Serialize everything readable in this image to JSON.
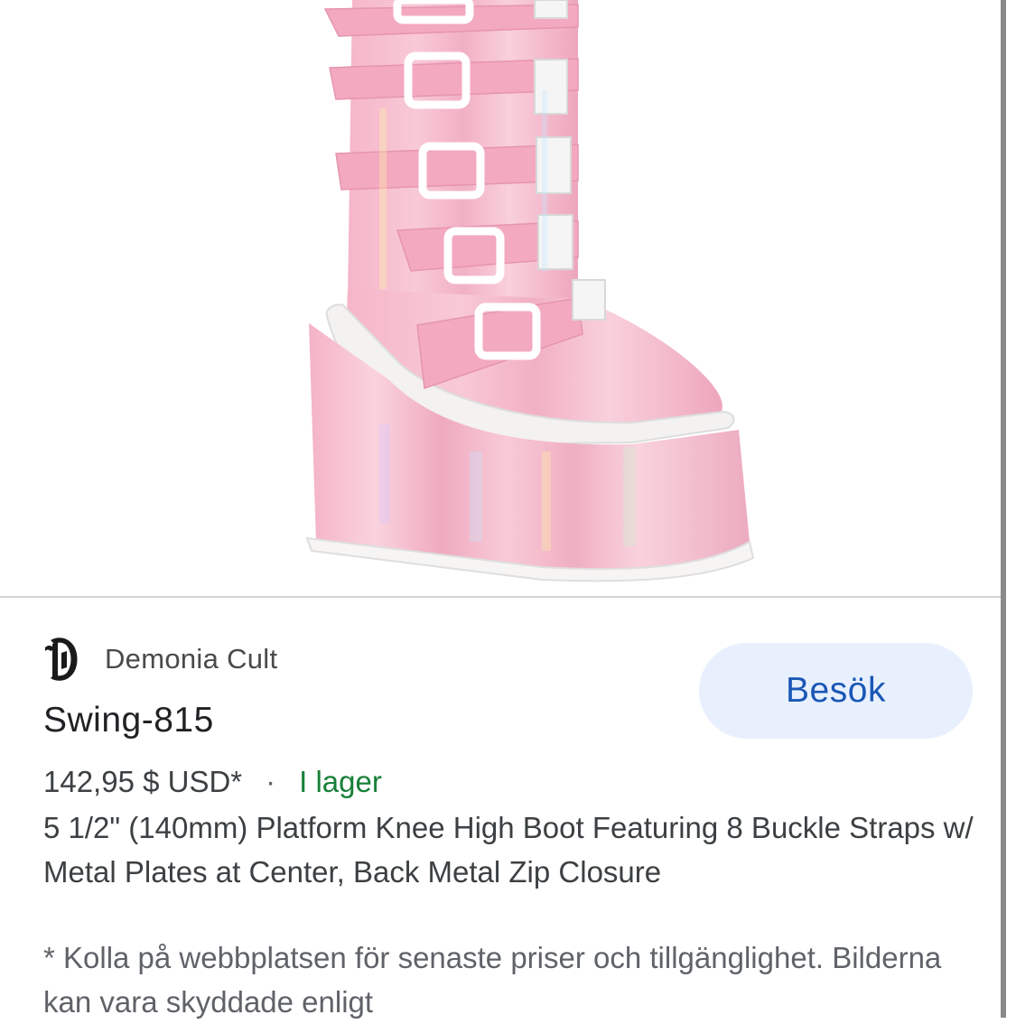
{
  "product_image": {
    "alt": "pink-holographic-platform-boot",
    "accent_color": "#f3b8c8"
  },
  "brand": {
    "name": "Demonia Cult",
    "logo_letter": "D"
  },
  "product": {
    "title": "Swing-815",
    "price": "142,95 $ USD*",
    "separator": "·",
    "stock": "I lager",
    "description": "5 1/2\" (140mm) Platform Knee High Boot Featuring 8 Buckle Straps w/ Metal Plates at Center, Back Metal Zip Closure"
  },
  "visit_button": {
    "label": "Besök"
  },
  "disclaimer": "* Kolla på webbplatsen för senaste priser och tillgänglighet. Bilderna kan vara skyddade enligt",
  "colors": {
    "link_blue": "#1a57b5",
    "button_bg": "#e8f0fe",
    "stock_green": "#188038"
  }
}
